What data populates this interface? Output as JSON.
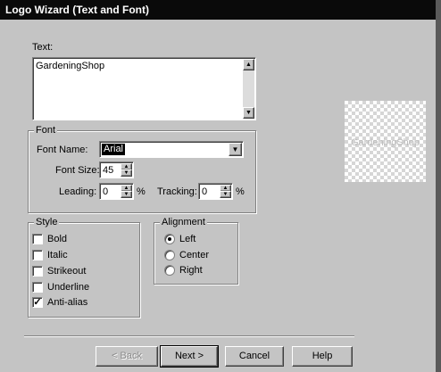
{
  "window": {
    "title": "Logo Wizard (Text and Font)"
  },
  "text_section": {
    "label": "Text:",
    "value": "GardeningShop"
  },
  "font_group": {
    "title": "Font",
    "font_name_label": "Font Name:",
    "font_name_value": "Arial",
    "font_size_label": "Font Size:",
    "font_size_value": "45",
    "leading_label": "Leading:",
    "leading_value": "0",
    "tracking_label": "Tracking:",
    "tracking_value": "0",
    "percent": "%"
  },
  "style_group": {
    "title": "Style",
    "options": [
      {
        "label": "Bold",
        "checked": false
      },
      {
        "label": "Italic",
        "checked": false
      },
      {
        "label": "Strikeout",
        "checked": false
      },
      {
        "label": "Underline",
        "checked": false
      },
      {
        "label": "Anti-alias",
        "checked": true
      }
    ]
  },
  "alignment_group": {
    "title": "Alignment",
    "options": [
      {
        "label": "Left",
        "selected": true
      },
      {
        "label": "Center",
        "selected": false
      },
      {
        "label": "Right",
        "selected": false
      }
    ]
  },
  "preview": {
    "text": "GardeningShop"
  },
  "buttons": {
    "back": "< Back",
    "next": "Next >",
    "cancel": "Cancel",
    "help": "Help"
  }
}
